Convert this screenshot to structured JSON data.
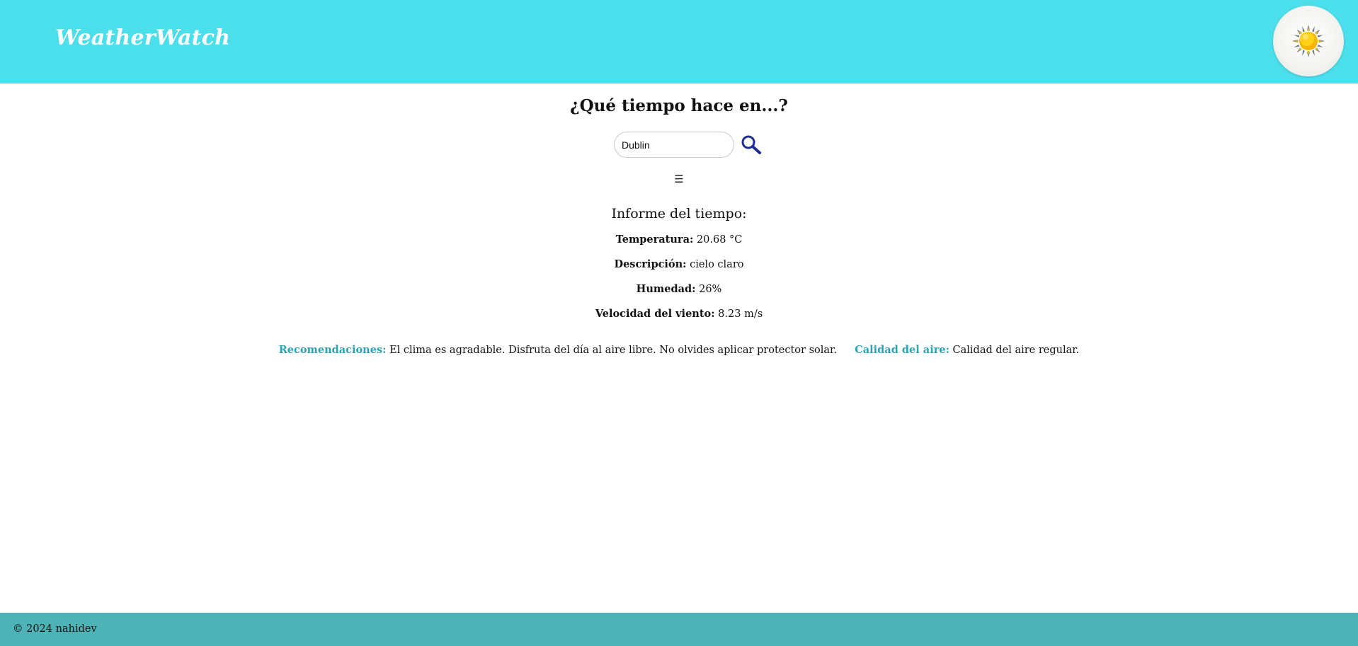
{
  "header": {
    "brand": "WeatherWatch",
    "weather_icon": "sun-icon",
    "accent_color": "#4adfeb"
  },
  "search": {
    "title": "¿Qué tiempo hace en...?",
    "value": "Dublin",
    "button_icon": "search-icon",
    "menu_icon": "☰"
  },
  "report": {
    "title": "Informe del tiempo:",
    "temperature_label": "Temperatura:",
    "temperature_value": "20.68 °C",
    "description_label": "Descripción:",
    "description_value": "cielo claro",
    "humidity_label": "Humedad:",
    "humidity_value": "26%",
    "wind_label": "Velocidad del viento:",
    "wind_value": "8.23 m/s"
  },
  "recommendations": {
    "label": "Recomendaciones:",
    "text": "El clima es agradable. Disfruta del día al aire libre. No olvides aplicar protector solar.",
    "air_label": "Calidad del aire:",
    "air_text": "Calidad del aire regular.",
    "label_color": "#2aa3b4"
  },
  "footer": {
    "text": "© 2024 nahidev",
    "color": "#4db3b6"
  }
}
